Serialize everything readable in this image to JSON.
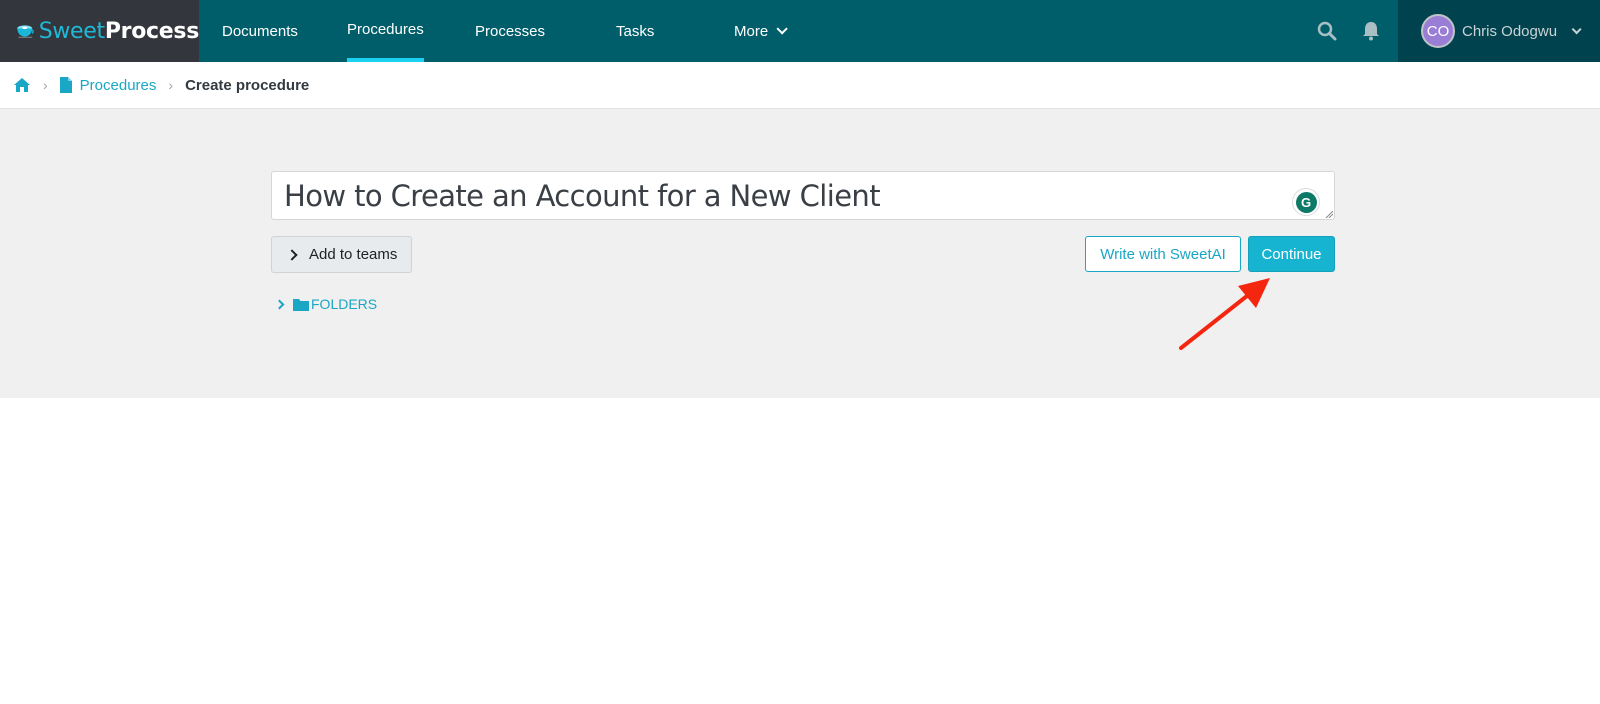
{
  "app": {
    "brand_part1": "Sweet",
    "brand_part2": "Process"
  },
  "nav": {
    "items": [
      {
        "label": "Documents",
        "active": false
      },
      {
        "label": "Procedures",
        "active": true
      },
      {
        "label": "Processes",
        "active": false
      },
      {
        "label": "Tasks",
        "active": false
      },
      {
        "label": "More",
        "active": false,
        "has_dropdown": true
      }
    ],
    "search_icon": "search-icon",
    "bell_icon": "bell-icon"
  },
  "user": {
    "initials": "CO",
    "name": "Chris Odogwu",
    "avatar_color": "#9a7ed6"
  },
  "breadcrumb": {
    "home_icon": "home-icon",
    "items": [
      {
        "label": "Procedures",
        "icon": "document-icon",
        "link": true
      },
      {
        "label": "Create procedure",
        "link": false
      }
    ]
  },
  "form": {
    "title_value": "How to Create an Account for a New Client",
    "add_to_teams_label": "Add to teams",
    "write_with_ai_label": "Write with SweetAI",
    "continue_label": "Continue",
    "folders_label": "FOLDERS"
  },
  "colors": {
    "topbar": "#005e6b",
    "logo_bg": "#33363d",
    "user_bg": "#00434e",
    "accent": "#1aa7c5",
    "active_underline": "#1ad1f1",
    "primary_button": "#17b4d2",
    "annotation_arrow": "#f5260f"
  }
}
